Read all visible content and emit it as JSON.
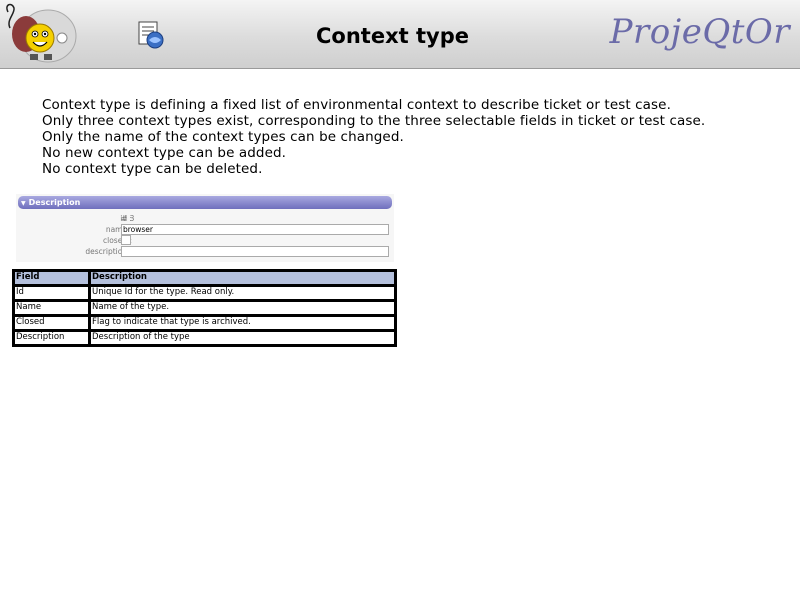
{
  "header": {
    "title": "Context type",
    "brand": "ProjeQtOr",
    "logo_icon": "mascot-logo-icon",
    "help_icon": "help-document-icon"
  },
  "intro": {
    "lines": [
      "Context type is defining a fixed list of environmental context to describe ticket or test case.",
      "Only three context types exist, corresponding to the three selectable fields in ticket or test case.",
      "Only the name of the context types can be changed.",
      "No new context type can be added.",
      "No context type can be deleted."
    ]
  },
  "form": {
    "section_title": "Description",
    "id_label": "id :",
    "id_value": "# 3",
    "name_label": "name :",
    "name_value": "browser",
    "closed_label": "closed :",
    "description_label": "description :",
    "description_value": ""
  },
  "fields_table": {
    "headers": [
      "Field",
      "Description"
    ],
    "rows": [
      [
        "Id",
        "Unique Id for the type. Read only."
      ],
      [
        "Name",
        "Name of the type."
      ],
      [
        "Closed",
        "Flag to indicate that type is archived."
      ],
      [
        "Description",
        "Description of the type"
      ]
    ]
  },
  "colors": {
    "brand": "#6b6ba8",
    "section_header": "#6f6fbd",
    "table_header": "#b4c0dc"
  }
}
